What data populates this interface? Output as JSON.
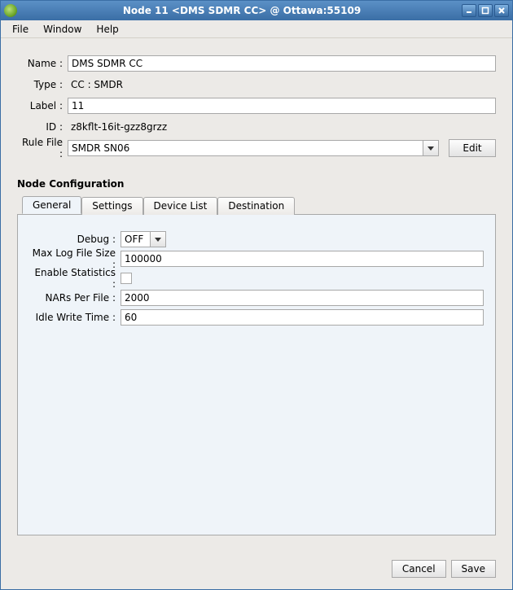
{
  "window": {
    "title": "Node 11 <DMS SDMR CC> @ Ottawa:55109"
  },
  "menubar": {
    "file": "File",
    "window": "Window",
    "help": "Help"
  },
  "form": {
    "name_label": "Name :",
    "name_value": "DMS SDMR CC",
    "type_label": "Type :",
    "type_value": "CC : SMDR",
    "label_label": "Label :",
    "label_value": "11",
    "id_label": "ID :",
    "id_value": "z8kflt-16it-gzz8grzz",
    "rulefile_label": "Rule File :",
    "rulefile_value": "SMDR SN06",
    "edit_button": "Edit"
  },
  "section": {
    "title": "Node Configuration",
    "tabs": {
      "general": "General",
      "settings": "Settings",
      "device_list": "Device List",
      "destination": "Destination"
    },
    "general": {
      "debug_label": "Debug :",
      "debug_value": "OFF",
      "maxlog_label": "Max Log File Size :",
      "maxlog_value": "100000",
      "enablestats_label": "Enable Statistics :",
      "enablestats_checked": false,
      "nars_label": "NARs Per File :",
      "nars_value": "2000",
      "idle_label": "Idle Write Time :",
      "idle_value": "60"
    }
  },
  "footer": {
    "cancel": "Cancel",
    "save": "Save"
  }
}
